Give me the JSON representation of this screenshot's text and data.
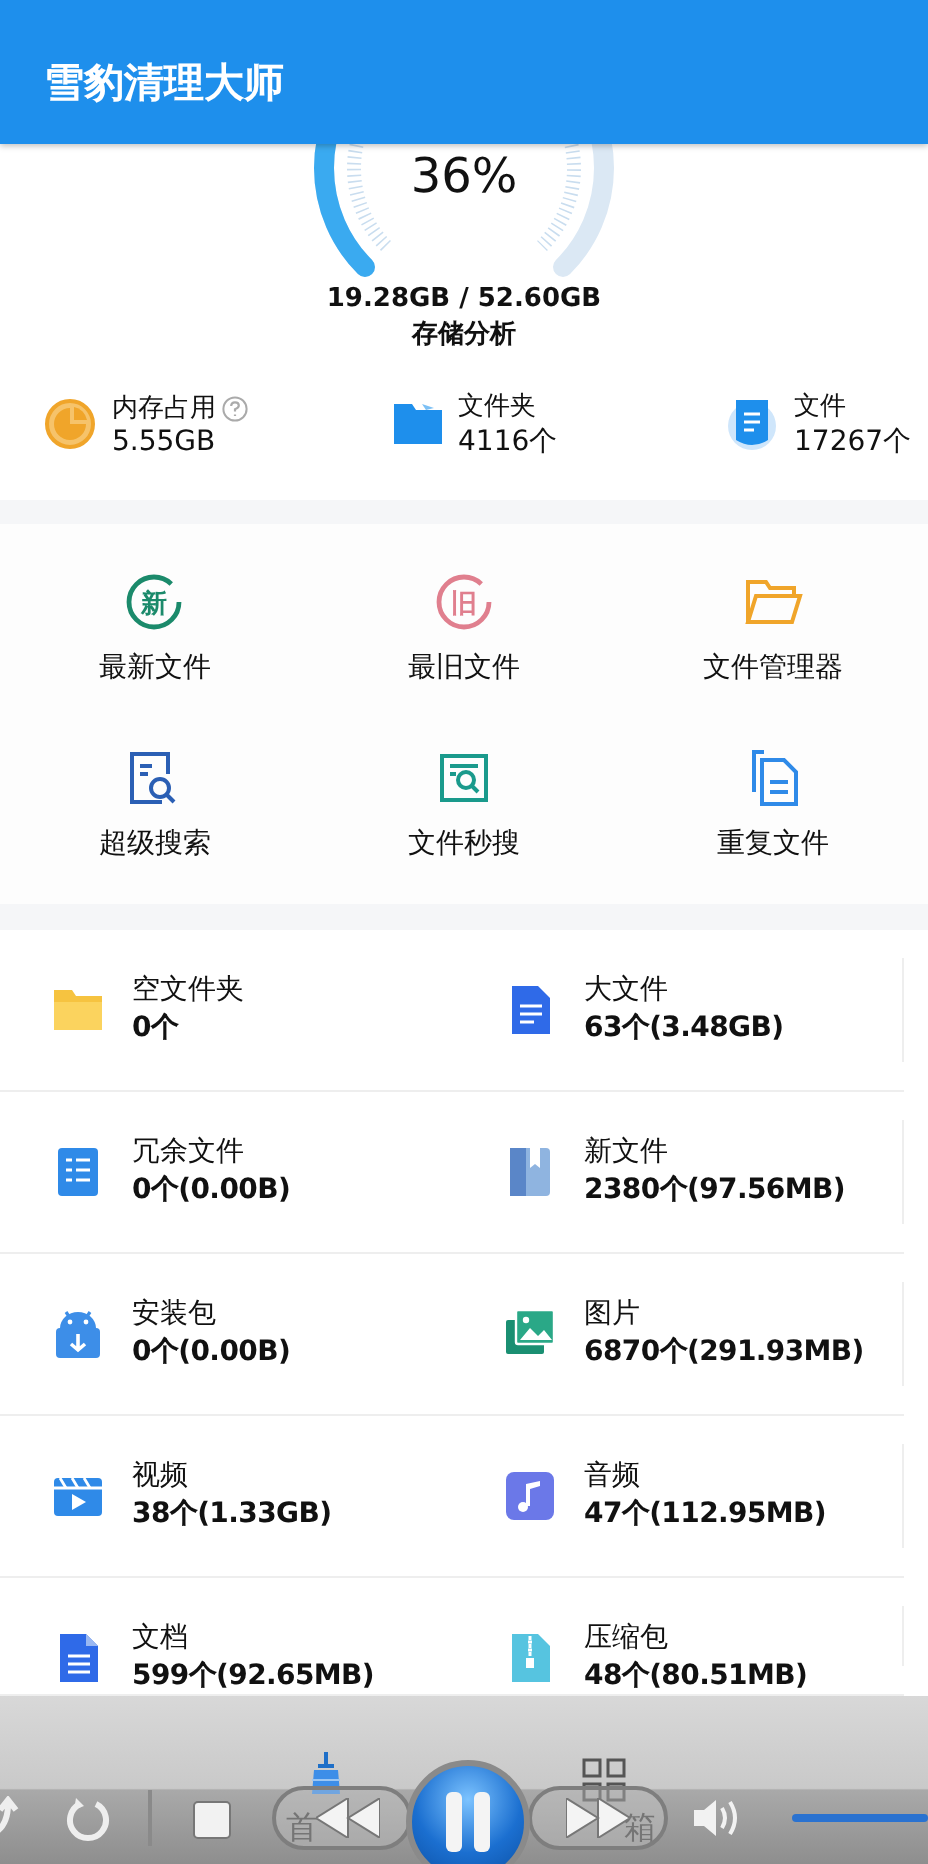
{
  "app_bar": {
    "title": "雪豹清理大师"
  },
  "storage": {
    "percent": "36%",
    "usage": "19.28GB / 52.60GB",
    "action": "存储分析"
  },
  "stats": [
    {
      "kind": "memory",
      "label": "内存占用",
      "value": "5.55GB",
      "help": true
    },
    {
      "kind": "folder",
      "label": "文件夹",
      "value": "4116个",
      "help": false
    },
    {
      "kind": "file",
      "label": "文件",
      "value": "17267个",
      "help": false
    }
  ],
  "tools": [
    {
      "kind": "new",
      "icon_text": "新",
      "label": "最新文件"
    },
    {
      "kind": "old",
      "icon_text": "旧",
      "label": "最旧文件"
    },
    {
      "kind": "manager",
      "label": "文件管理器"
    },
    {
      "kind": "super-search",
      "label": "超级搜索"
    },
    {
      "kind": "quick-search",
      "label": "文件秒搜"
    },
    {
      "kind": "duplicate",
      "label": "重复文件"
    }
  ],
  "categories": [
    {
      "kind": "empty-folder",
      "name": "空文件夹",
      "detail": "0个"
    },
    {
      "kind": "large-file",
      "name": "大文件",
      "detail": "63个(3.48GB)"
    },
    {
      "kind": "redundant",
      "name": "冗余文件",
      "detail": "0个(0.00B)"
    },
    {
      "kind": "new-file",
      "name": "新文件",
      "detail": "2380个(97.56MB)"
    },
    {
      "kind": "apk",
      "name": "安装包",
      "detail": "0个(0.00B)"
    },
    {
      "kind": "image",
      "name": "图片",
      "detail": "6870个(291.93MB)"
    },
    {
      "kind": "video",
      "name": "视频",
      "detail": "38个(1.33GB)"
    },
    {
      "kind": "audio",
      "name": "音频",
      "detail": "47个(112.95MB)"
    },
    {
      "kind": "document",
      "name": "文档",
      "detail": "599个(92.65MB)"
    },
    {
      "kind": "archive",
      "name": "压缩包",
      "detail": "48个(80.51MB)"
    }
  ],
  "bottom_nav": [
    {
      "kind": "home",
      "label": "首"
    },
    {
      "kind": "toolbox",
      "label": "箱"
    }
  ],
  "player": {
    "playing": true
  }
}
